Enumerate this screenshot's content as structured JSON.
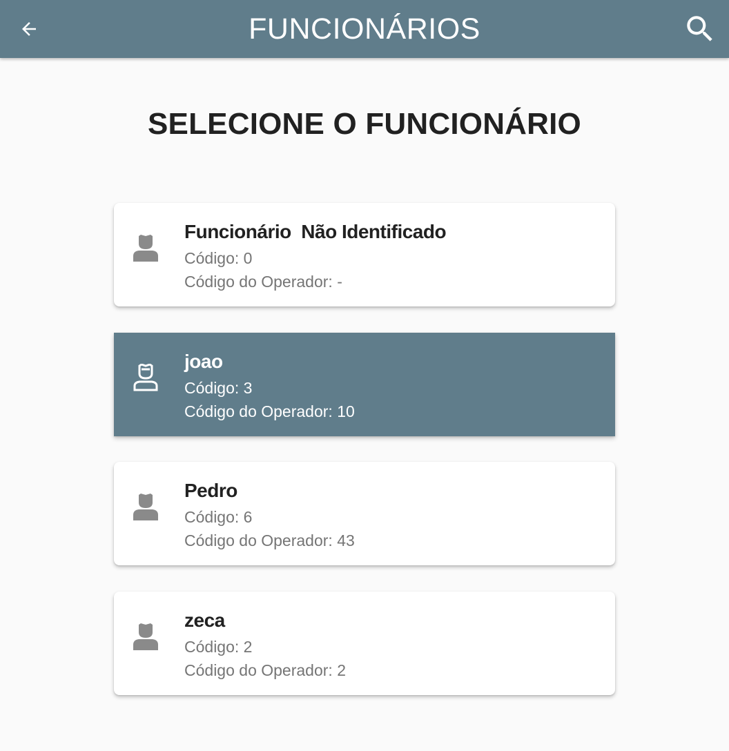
{
  "appbar": {
    "title": "FUNCIONÁRIOS",
    "back_icon": "arrow-back-icon",
    "search_icon": "search-icon",
    "color": "#607d8b"
  },
  "heading": "SELECIONE O FUNCIONÁRIO",
  "employees": [
    {
      "name": "Funcionário  Não Identificado",
      "code": "Código: 0",
      "operator_code": "Código do Operador: -",
      "selected": false
    },
    {
      "name": "joao",
      "code": "Código: 3",
      "operator_code": "Código do Operador: 10",
      "selected": true
    },
    {
      "name": "Pedro",
      "code": "Código: 6",
      "operator_code": "Código do Operador: 43",
      "selected": false
    },
    {
      "name": "zeca",
      "code": "Código: 2",
      "operator_code": "Código do Operador: 2",
      "selected": false
    }
  ],
  "icons": {
    "person": "person-icon",
    "person_selected": "person-outline-icon"
  },
  "colors": {
    "selected_bg": "#607d8b",
    "icon_gray": "#8a8a8a",
    "secondary_text": "#757575"
  }
}
